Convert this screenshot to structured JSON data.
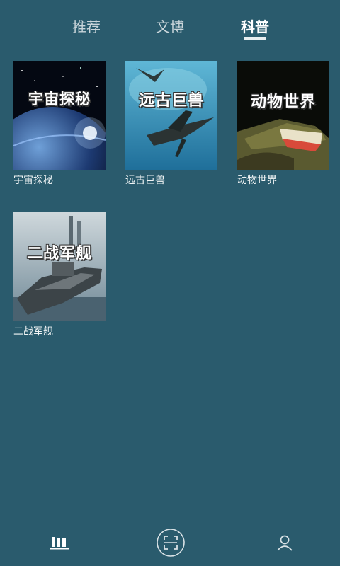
{
  "tabs": [
    {
      "label": "推荐",
      "active": false
    },
    {
      "label": "文博",
      "active": false
    },
    {
      "label": "科普",
      "active": true
    }
  ],
  "cards": [
    {
      "cover_text": "宇宙探秘",
      "label": "宇宙探秘"
    },
    {
      "cover_text": "远古巨兽",
      "label": "远古巨兽"
    },
    {
      "cover_text": "动物世界",
      "label": "动物世界"
    },
    {
      "cover_text": "二战军舰",
      "label": "二战军舰"
    }
  ],
  "bottom_nav": [
    {
      "icon": "library-icon",
      "active": true
    },
    {
      "icon": "scan-icon",
      "active": false
    },
    {
      "icon": "profile-icon",
      "active": false
    }
  ],
  "colors": {
    "background": "#2a5b6d",
    "active_tab": "#ffffff",
    "inactive_tab": "#c9d5da"
  }
}
